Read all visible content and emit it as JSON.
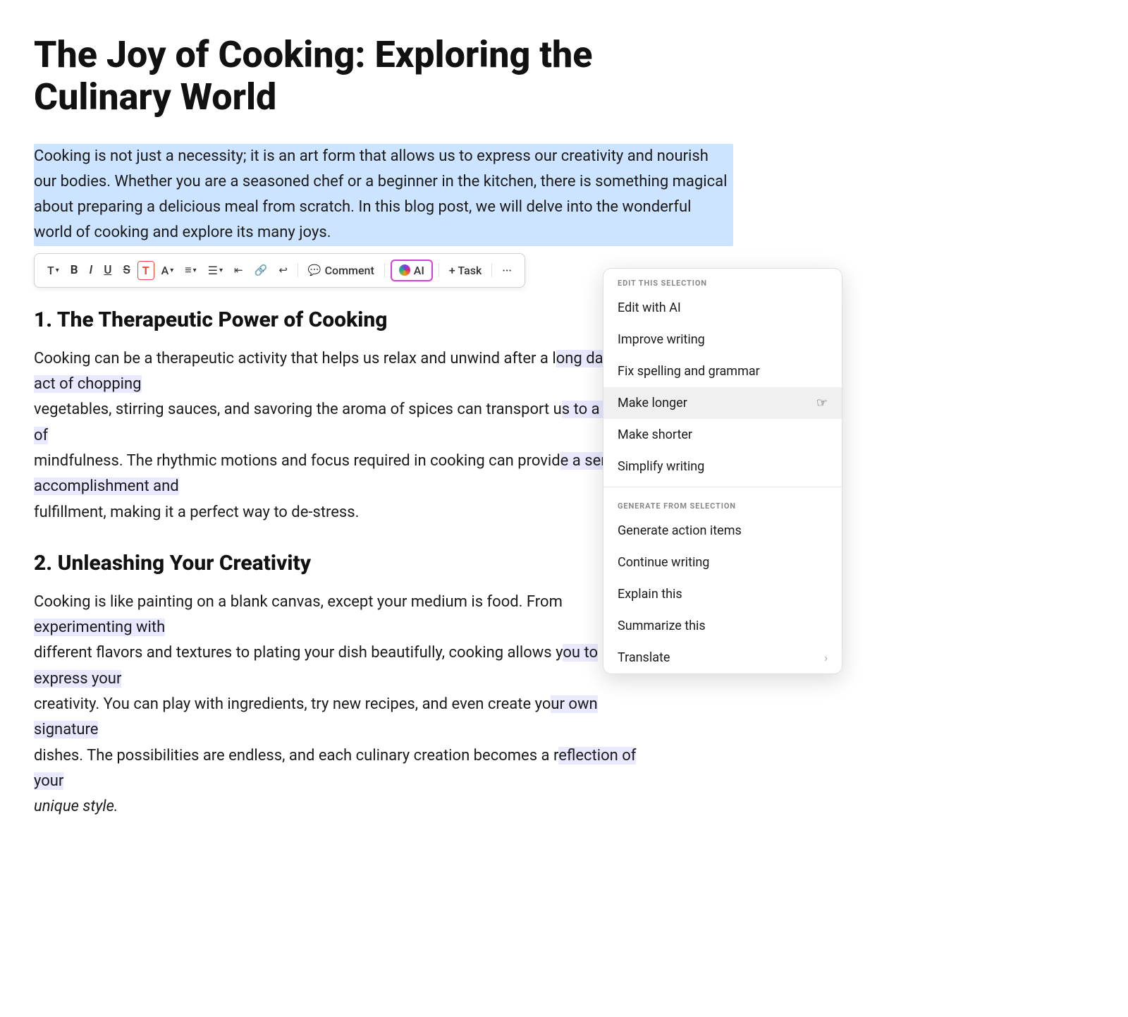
{
  "document": {
    "title": "The Joy of Cooking: Exploring the Culinary World",
    "selected_paragraph": "Cooking is not just a necessity; it is an art form that allows us to express our creativity and nourish our bodies. Whether you are a seasoned chef or a beginner in the kitchen, there is something magical about preparing a delicious meal from scratch. In this blog post, we will delve into the wonderful world of cooking and explore its many joys.",
    "section1_heading": "1. The Therapeutic Power of Cooking",
    "section1_body": "Cooking can be a therapeutic activity that helps us relax and unwind after a long day. The act of chopping vegetables, stirring sauces, and savoring the aroma of spices can transport us to a state of mindfulness. The rhythmic motions and focus required in cooking can provide a sense of accomplishment and fulfillment, making it a perfect way to de-stress.",
    "section2_heading": "2. Unleashing Your Creativity",
    "section2_body": "Cooking is like painting on a blank canvas, except your medium is food. From experimenting with different flavors and textures to plating your dish beautifully, cooking allows you to express your creativity. You can play with ingredients, try new recipes, and even create your own signature dishes. The possibilities are endless, and each culinary creation becomes a reflection of your unique style."
  },
  "toolbar": {
    "text_label": "T",
    "bold_label": "B",
    "italic_label": "I",
    "underline_label": "U",
    "strikethrough_label": "S",
    "highlight_label": "T",
    "font_label": "A",
    "align_label": "≡",
    "list_label": "☰",
    "outdent_label": "⇤",
    "link_label": "🔗",
    "indent_label": "⤦",
    "comment_label": "Comment",
    "ai_label": "AI",
    "task_label": "+ Task",
    "more_label": "···"
  },
  "dropdown": {
    "edit_section_label": "EDIT THIS SELECTION",
    "generate_section_label": "GENERATE FROM SELECTION",
    "edit_items": [
      {
        "id": "edit-with-ai",
        "label": "Edit with AI",
        "has_arrow": false
      },
      {
        "id": "improve-writing",
        "label": "Improve writing",
        "has_arrow": false
      },
      {
        "id": "fix-spelling",
        "label": "Fix spelling and grammar",
        "has_arrow": false
      },
      {
        "id": "make-longer",
        "label": "Make longer",
        "has_arrow": false,
        "active": true
      },
      {
        "id": "make-shorter",
        "label": "Make shorter",
        "has_arrow": false
      },
      {
        "id": "simplify-writing",
        "label": "Simplify writing",
        "has_arrow": false
      }
    ],
    "generate_items": [
      {
        "id": "generate-action-items",
        "label": "Generate action items",
        "has_arrow": false
      },
      {
        "id": "continue-writing",
        "label": "Continue writing",
        "has_arrow": false
      },
      {
        "id": "explain-this",
        "label": "Explain this",
        "has_arrow": false
      },
      {
        "id": "summarize-this",
        "label": "Summarize this",
        "has_arrow": false
      },
      {
        "id": "translate",
        "label": "Translate",
        "has_arrow": true
      }
    ]
  }
}
